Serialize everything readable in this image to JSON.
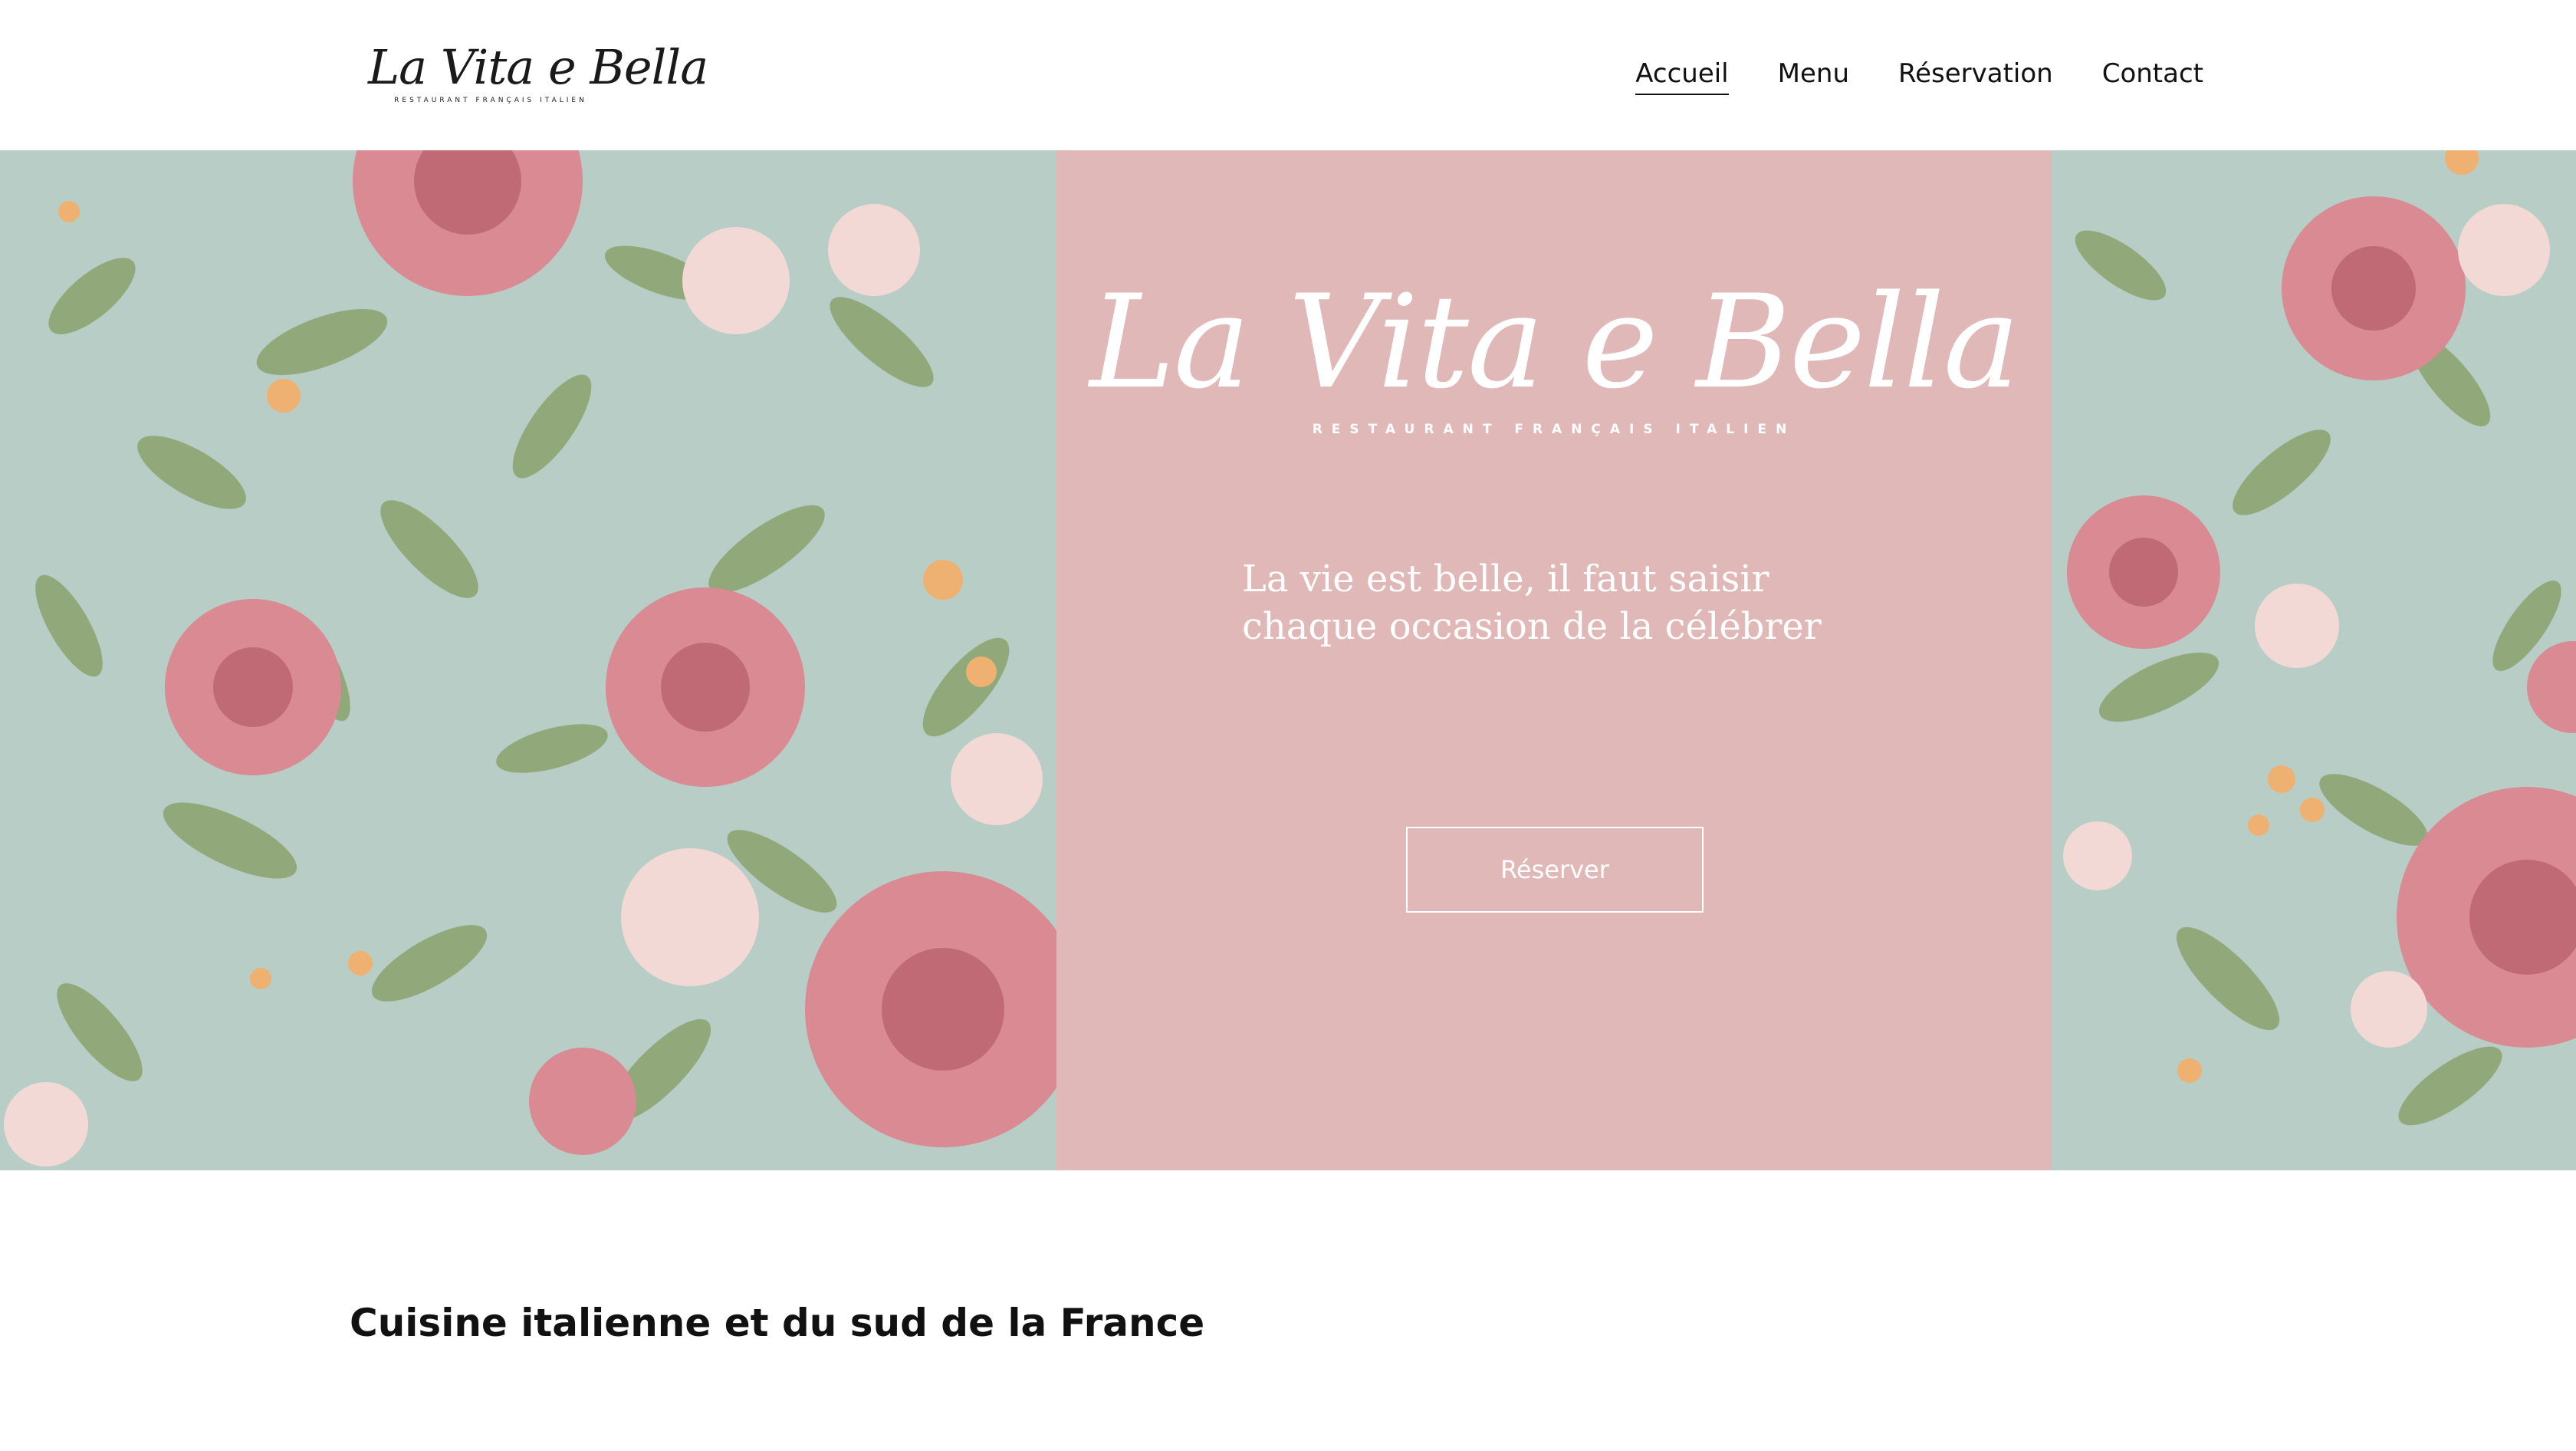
{
  "header": {
    "logo": {
      "script": "La Vita e Bella",
      "tagline": "RESTAURANT FRANÇAIS ITALIEN"
    },
    "nav": [
      {
        "label": "Accueil",
        "active": true
      },
      {
        "label": "Menu",
        "active": false
      },
      {
        "label": "Réservation",
        "active": false
      },
      {
        "label": "Contact",
        "active": false
      }
    ]
  },
  "hero": {
    "logo": {
      "script": "La Vita e Bella",
      "tagline": "RESTAURANT FRANÇAIS ITALIEN"
    },
    "quote": "La vie est belle, il faut saisir chaque occasion de la célébrer",
    "button_label": "Réserver",
    "colors": {
      "panel": "#e0b8b8",
      "floral_background": "#b7cdc6",
      "rose": "#d98a92",
      "blossom": "#f3d9d6",
      "leaf": "#8fa676",
      "accent_flower": "#eeb172"
    }
  },
  "section": {
    "title": "Cuisine italienne et du sud de la France"
  }
}
